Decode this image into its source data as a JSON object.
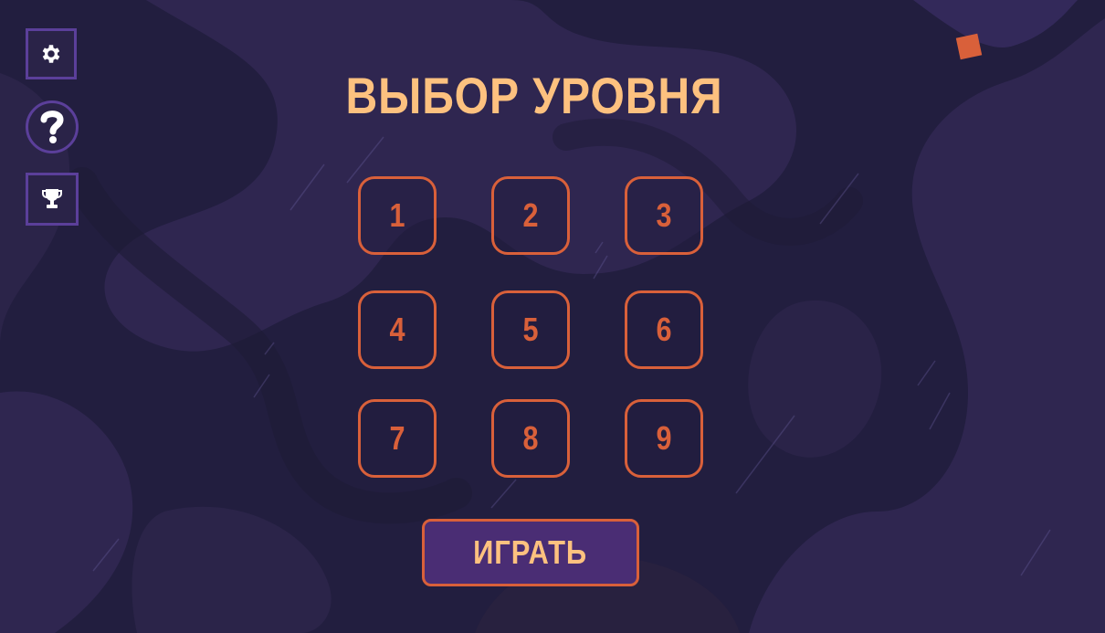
{
  "screen": {
    "title": "ВЫБОР УРОВНЯ",
    "play_label": "ИГРАТЬ"
  },
  "sidebar": {
    "buttons": [
      {
        "id": "settings",
        "icon": "gear-icon"
      },
      {
        "id": "help",
        "icon": "question-icon"
      },
      {
        "id": "achievements",
        "icon": "trophy-icon"
      }
    ]
  },
  "levels": [
    {
      "label": "1"
    },
    {
      "label": "2"
    },
    {
      "label": "3"
    },
    {
      "label": "4"
    },
    {
      "label": "5"
    },
    {
      "label": "6"
    },
    {
      "label": "7"
    },
    {
      "label": "8"
    },
    {
      "label": "9"
    }
  ],
  "colors": {
    "background": "#221e3f",
    "blob_light": "#31274f",
    "accent_orange": "#d9603a",
    "title_peach": "#fdc17f",
    "button_purple": "#4a2d74",
    "border_purple": "#5b3f9a"
  }
}
